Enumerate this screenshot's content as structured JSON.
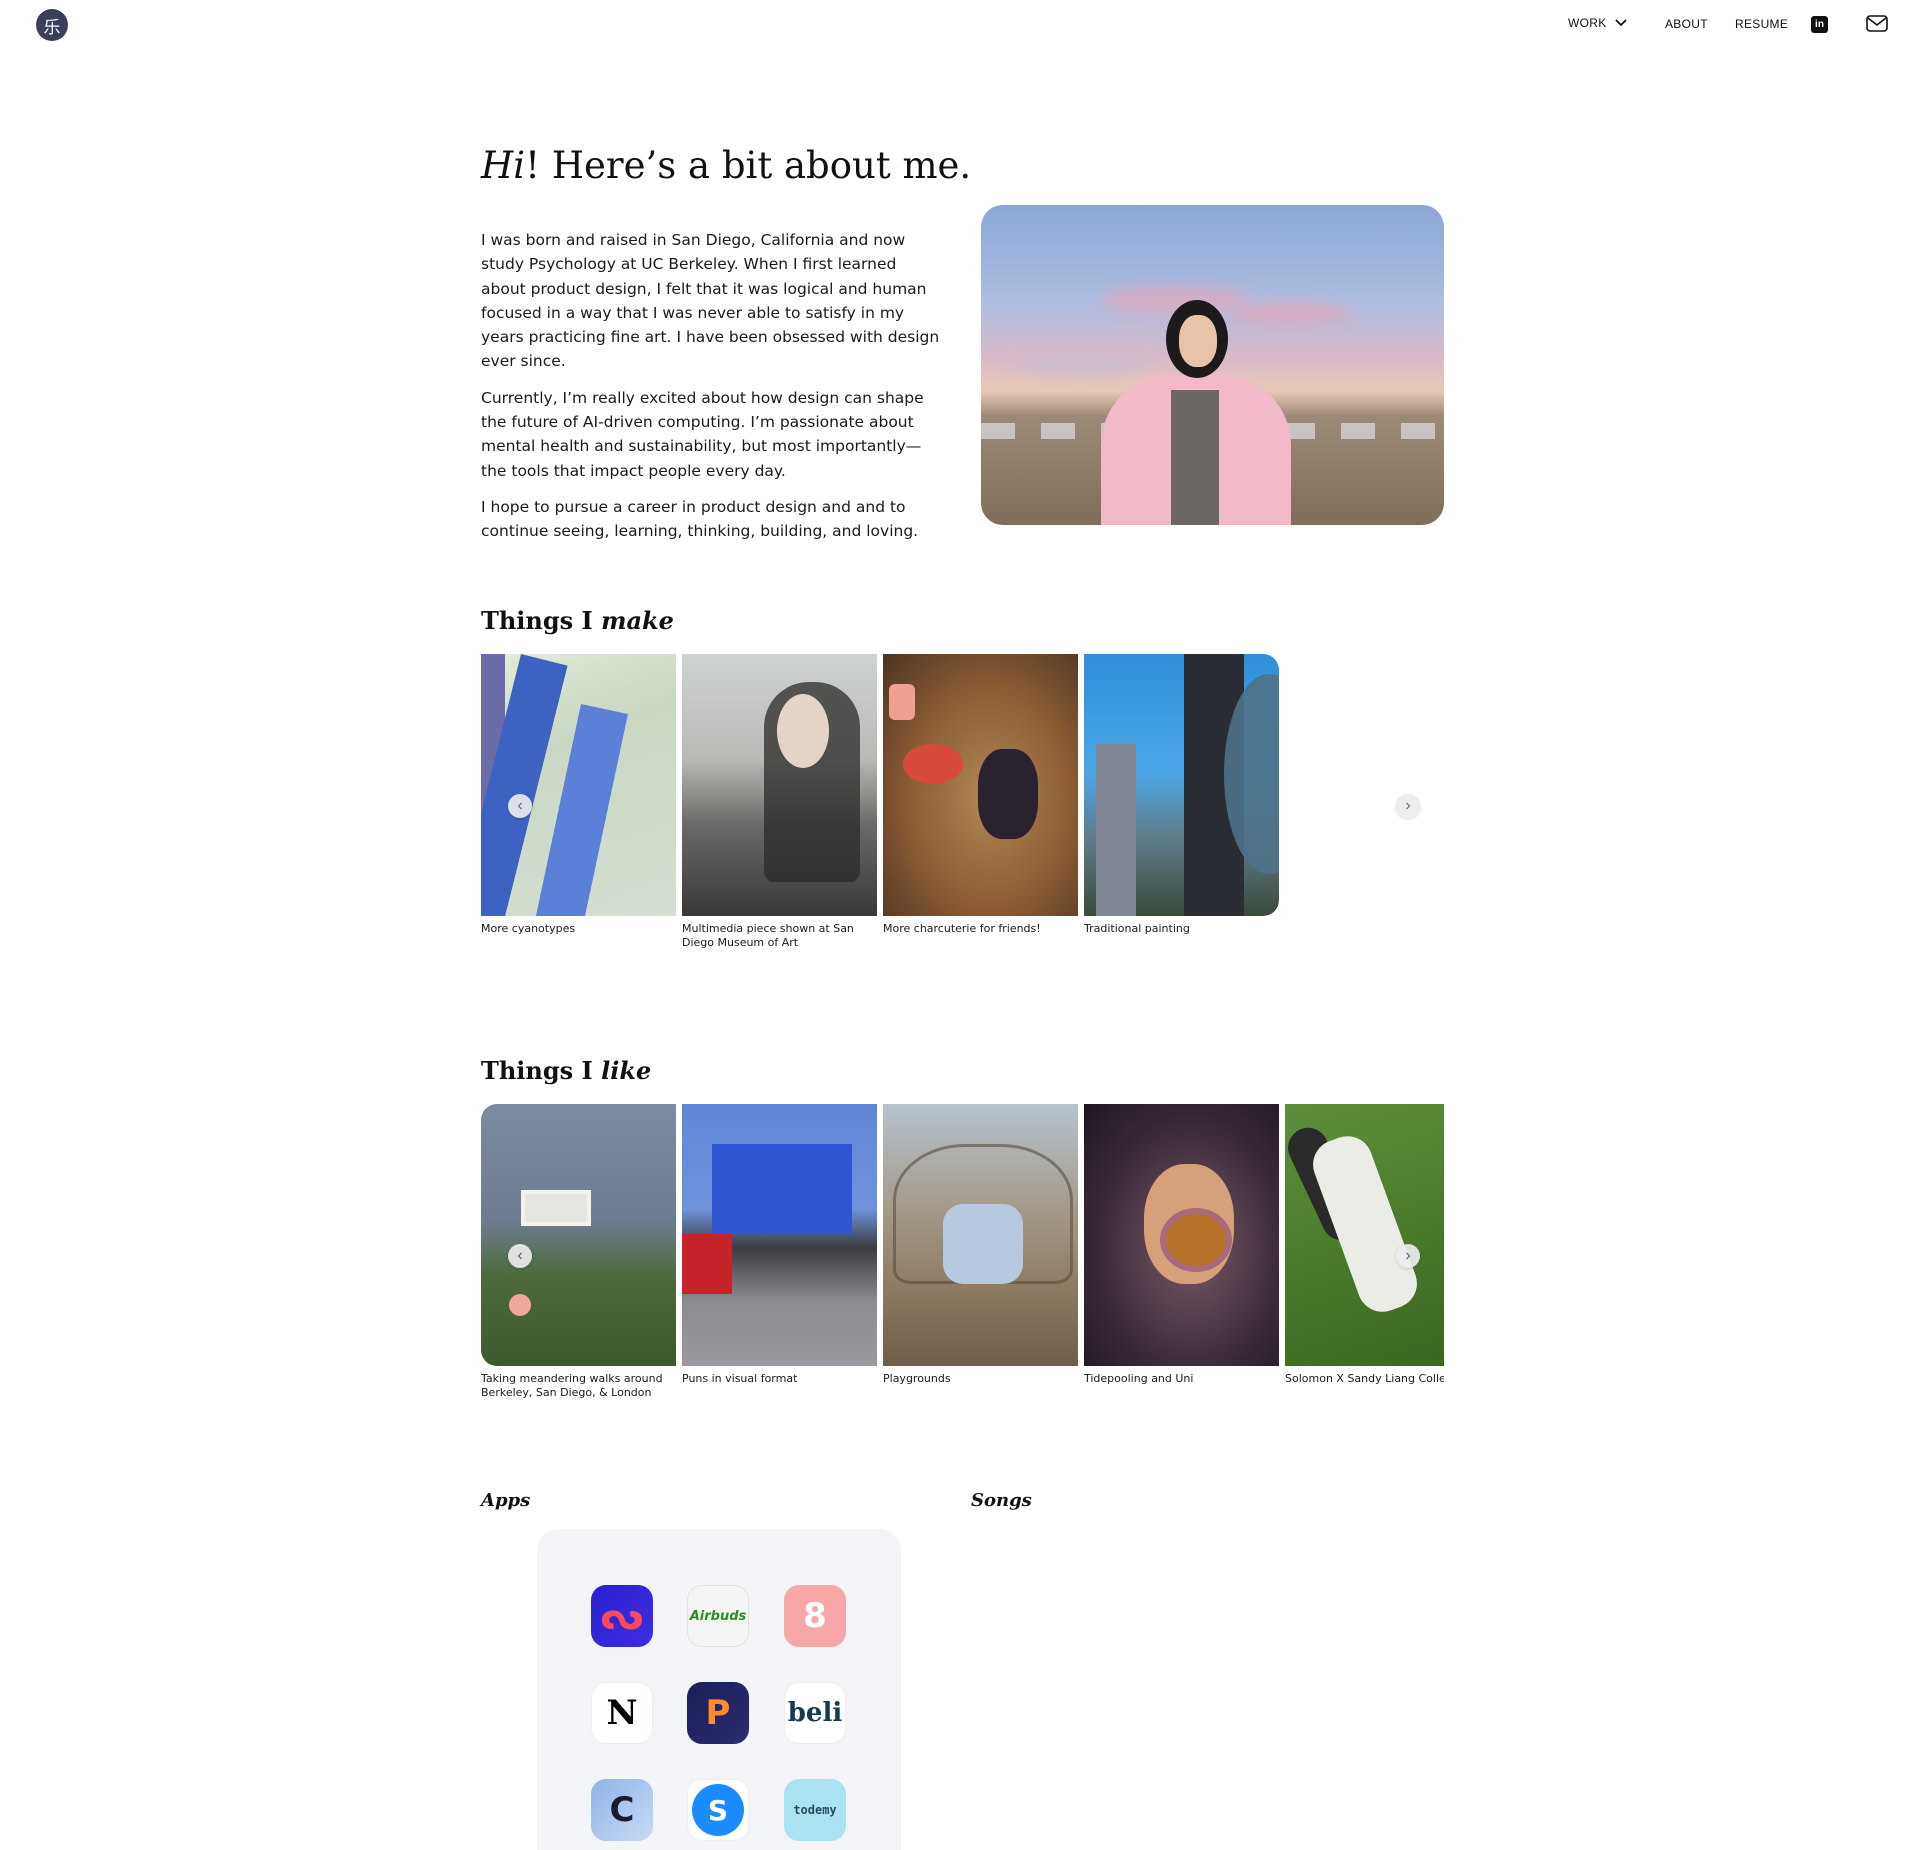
{
  "header": {
    "logo_glyph": "乐",
    "nav": {
      "work": "WORK",
      "about": "ABOUT",
      "resume": "RESUME"
    },
    "icons": [
      "chevron-down-icon",
      "linkedin-icon",
      "mail-icon"
    ]
  },
  "intro": {
    "title_italic": "Hi",
    "title_rest": "! Here’s a bit about me.",
    "paragraphs": [
      "I was born and raised in San Diego, California and now study Psychology at UC Berkeley. When I first learned about product design, I felt that it was logical and human focused in a way that I was never able to satisfy in my years practicing fine art. I have been obsessed with design ever since.",
      "Currently, I’m really excited about how design can shape the future of AI-driven computing. I’m passionate about mental health and sustainability, but most importantly—the tools that impact people every day.",
      "I hope to pursue a career in product design and and to continue seeing, learning, thinking, building, and loving."
    ]
  },
  "make": {
    "title_prefix": "Things I ",
    "title_italic": "make",
    "items": [
      {
        "caption": "More cyanotypes"
      },
      {
        "caption": "Multimedia piece shown at San Diego Museum of Art"
      },
      {
        "caption": "More charcuterie for friends!"
      },
      {
        "caption": "Traditional painting"
      }
    ]
  },
  "like": {
    "title_prefix": "Things I ",
    "title_italic": "like",
    "items": [
      {
        "caption": "Taking meandering walks around Berkeley, San Diego, & London"
      },
      {
        "caption": "Puns in visual format"
      },
      {
        "caption": "Playgrounds"
      },
      {
        "caption": "Tidepooling and Uni"
      },
      {
        "caption": "Solomon X Sandy Liang Collec"
      }
    ]
  },
  "apps": {
    "title": "Apps",
    "icons": [
      {
        "name": "app-icon-1",
        "glyph": "ᔓ"
      },
      {
        "name": "app-icon-airbuds",
        "glyph": "Airbuds"
      },
      {
        "name": "app-icon-3",
        "glyph": "8"
      },
      {
        "name": "app-icon-notion",
        "glyph": "N"
      },
      {
        "name": "app-icon-5",
        "glyph": "P"
      },
      {
        "name": "app-icon-beli",
        "glyph": "beli"
      },
      {
        "name": "app-icon-7",
        "glyph": "C"
      },
      {
        "name": "app-icon-shazam",
        "glyph": "S"
      },
      {
        "name": "app-icon-todemy",
        "glyph": "todemy"
      }
    ]
  },
  "songs": {
    "title": "Songs"
  },
  "colors": {
    "text": "#1a1a1a",
    "logo_bg": "#3b3f5c",
    "apps_panel": "#f3f4f7"
  }
}
